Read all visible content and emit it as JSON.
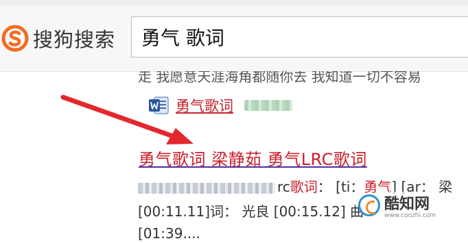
{
  "header": {
    "logo_text": "搜狗搜索",
    "search_value": "勇气 歌词"
  },
  "results": {
    "cut_off_line": "走 我愿意天涯海角都随你去 我知道一切不容易",
    "doc_link": "勇气歌词",
    "main_title": "勇气歌词 梁静茹 勇气LRC歌词",
    "snippet": {
      "line1_a": "rc",
      "line1_kw1": "歌词",
      "line1_b": "： [ti：",
      "line1_kw2": "勇气",
      "line1_c": "] [ar： 梁",
      "line2": "[00:11.11]词： 光良 [00:15.12] 曲",
      "line3": "[01:39...."
    }
  },
  "watermark": {
    "name": "酷知网",
    "url": "www.coozhi.com"
  },
  "colors": {
    "link_red": "#cc1f2b",
    "arrow_red": "#e3282d",
    "logo_orange": "#f36c21"
  }
}
